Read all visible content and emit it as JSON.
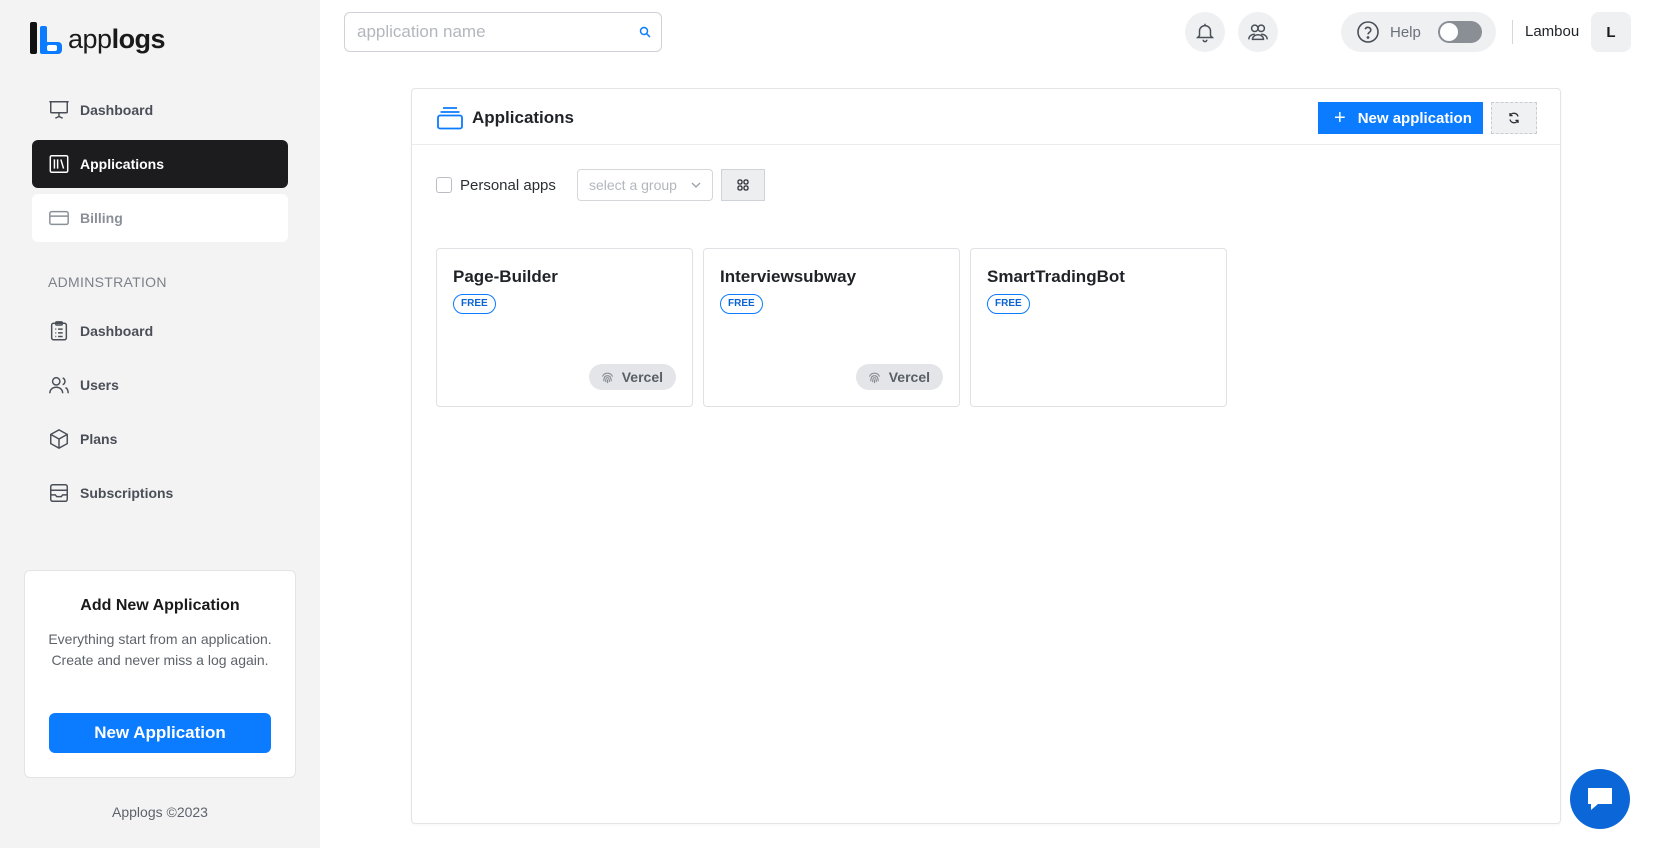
{
  "app": {
    "name_light": "app",
    "name_bold": "logs",
    "brand_color": "#0b7bff"
  },
  "search": {
    "placeholder": "application name",
    "value": ""
  },
  "sidebar": {
    "items": [
      {
        "label": "Dashboard",
        "icon": "presentation-icon",
        "state": "default"
      },
      {
        "label": "Applications",
        "icon": "library-icon",
        "state": "active"
      },
      {
        "label": "Billing",
        "icon": "credit-card-icon",
        "state": "highlighted"
      }
    ],
    "section_label": "ADMINSTRATION",
    "admin_items": [
      {
        "label": "Dashboard",
        "icon": "clipboard-icon"
      },
      {
        "label": "Users",
        "icon": "users-icon"
      },
      {
        "label": "Plans",
        "icon": "box-icon"
      },
      {
        "label": "Subscriptions",
        "icon": "archive-icon"
      }
    ],
    "promo": {
      "title": "Add New Application",
      "text": "Everything start from an application. Create and never miss a log again.",
      "button": "New Application"
    },
    "copyright": "Applogs ©2023"
  },
  "header": {
    "help_label": "Help",
    "help_toggle_on": false,
    "username": "Lambou",
    "avatar_initial": "L"
  },
  "main": {
    "title": "Applications",
    "new_button": "New application",
    "filters": {
      "personal_label": "Personal apps",
      "personal_checked": false,
      "group_placeholder": "select a group"
    },
    "apps": [
      {
        "name": "Page-Builder",
        "plan": "FREE",
        "provider": "Vercel"
      },
      {
        "name": "Interviewsubway",
        "plan": "FREE",
        "provider": "Vercel"
      },
      {
        "name": "SmartTradingBot",
        "plan": "FREE",
        "provider": ""
      }
    ]
  }
}
